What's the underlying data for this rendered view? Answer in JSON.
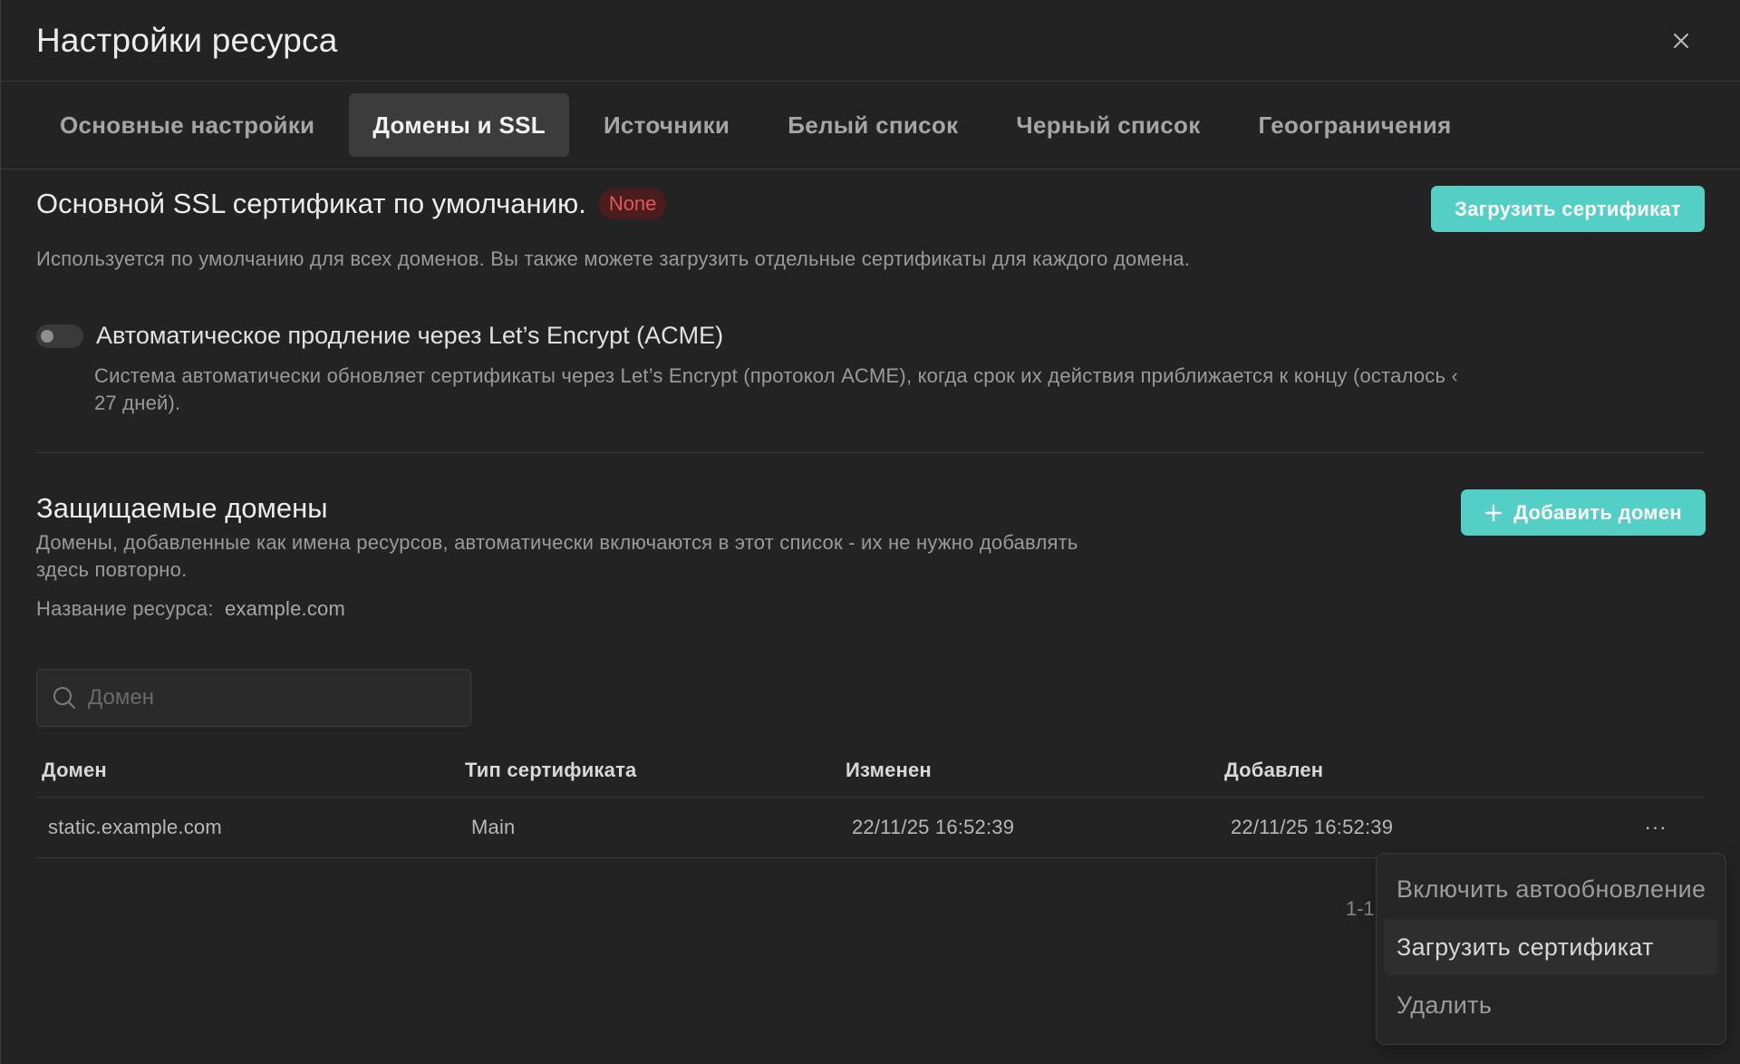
{
  "header": {
    "title": "Настройки ресурса"
  },
  "tabs": [
    {
      "label": "Основные настройки"
    },
    {
      "label": "Домены и SSL"
    },
    {
      "label": "Источники"
    },
    {
      "label": "Белый список"
    },
    {
      "label": "Черный список"
    },
    {
      "label": "Геоограничения"
    }
  ],
  "ssl": {
    "title": "Основной SSL сертификат по умолчанию.",
    "badge": "None",
    "upload_button": "Загрузить сертификат",
    "description": "Используется по умолчанию для всех доменов. Вы также можете загрузить отдельные сертификаты для каждого домена.",
    "acme_label": "Автоматическое продление через Let’s Encrypt (ACME)",
    "acme_enabled": false,
    "acme_description": "Система автоматически обновляет сертификаты через Let’s Encrypt (протокол ACME), когда срок их действия приближается к концу (осталось ‹ 27 дней)."
  },
  "domains": {
    "title": "Защищаемые домены",
    "description": "Домены, добавленные как имена ресурсов, автоматически включаются в этот список - их не нужно добавлять здесь повторно.",
    "resource_label": "Название ресурса:",
    "resource_value": "example.com",
    "add_button": "Добавить домен",
    "search_placeholder": "Домен",
    "columns": [
      "Домен",
      "Тип сертификата",
      "Изменен",
      "Добавлен"
    ],
    "rows": [
      {
        "domain": "static.example.com",
        "cert_type": "Main",
        "modified": "22/11/25 16:52:39",
        "added": "22/11/25 16:52:39"
      }
    ],
    "more_label": "···",
    "pagination": "1-1"
  },
  "row_menu": {
    "items": [
      {
        "label": "Включить автообновление"
      },
      {
        "label": "Загрузить сертификат"
      },
      {
        "label": "Удалить"
      }
    ]
  },
  "colors": {
    "accent": "#53cfc6",
    "background": "#232323",
    "badge_error": "#e0595a"
  },
  "icons": {
    "close": "close-icon",
    "search": "search-icon",
    "plus": "plus-icon",
    "more": "more-horizontal-icon"
  }
}
